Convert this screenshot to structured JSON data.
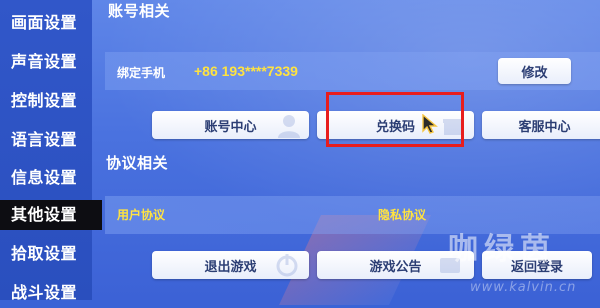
{
  "sidebar": {
    "items": [
      {
        "label": "画面设置"
      },
      {
        "label": "声音设置"
      },
      {
        "label": "控制设置"
      },
      {
        "label": "语言设置"
      },
      {
        "label": "信息设置"
      },
      {
        "label": "其他设置",
        "active": true
      },
      {
        "label": "拾取设置"
      },
      {
        "label": "战斗设置"
      }
    ]
  },
  "account": {
    "title": "账号相关",
    "bind_phone_label": "绑定手机",
    "phone": "+86 193****7339",
    "modify_label": "修改",
    "buttons": [
      "账号中心",
      "兑换码",
      "客服中心"
    ]
  },
  "protocol": {
    "title": "协议相关",
    "user_agreement": "用户协议",
    "privacy_agreement": "隐私协议",
    "buttons": [
      "退出游戏",
      "游戏公告",
      "返回登录"
    ]
  },
  "watermark": {
    "text": "咖绿茵",
    "url": "www.kalvin.cn"
  },
  "colors": {
    "highlight": "#e81d1d",
    "accent_yellow": "#ffe340",
    "active_nav": "#0d0d12"
  }
}
